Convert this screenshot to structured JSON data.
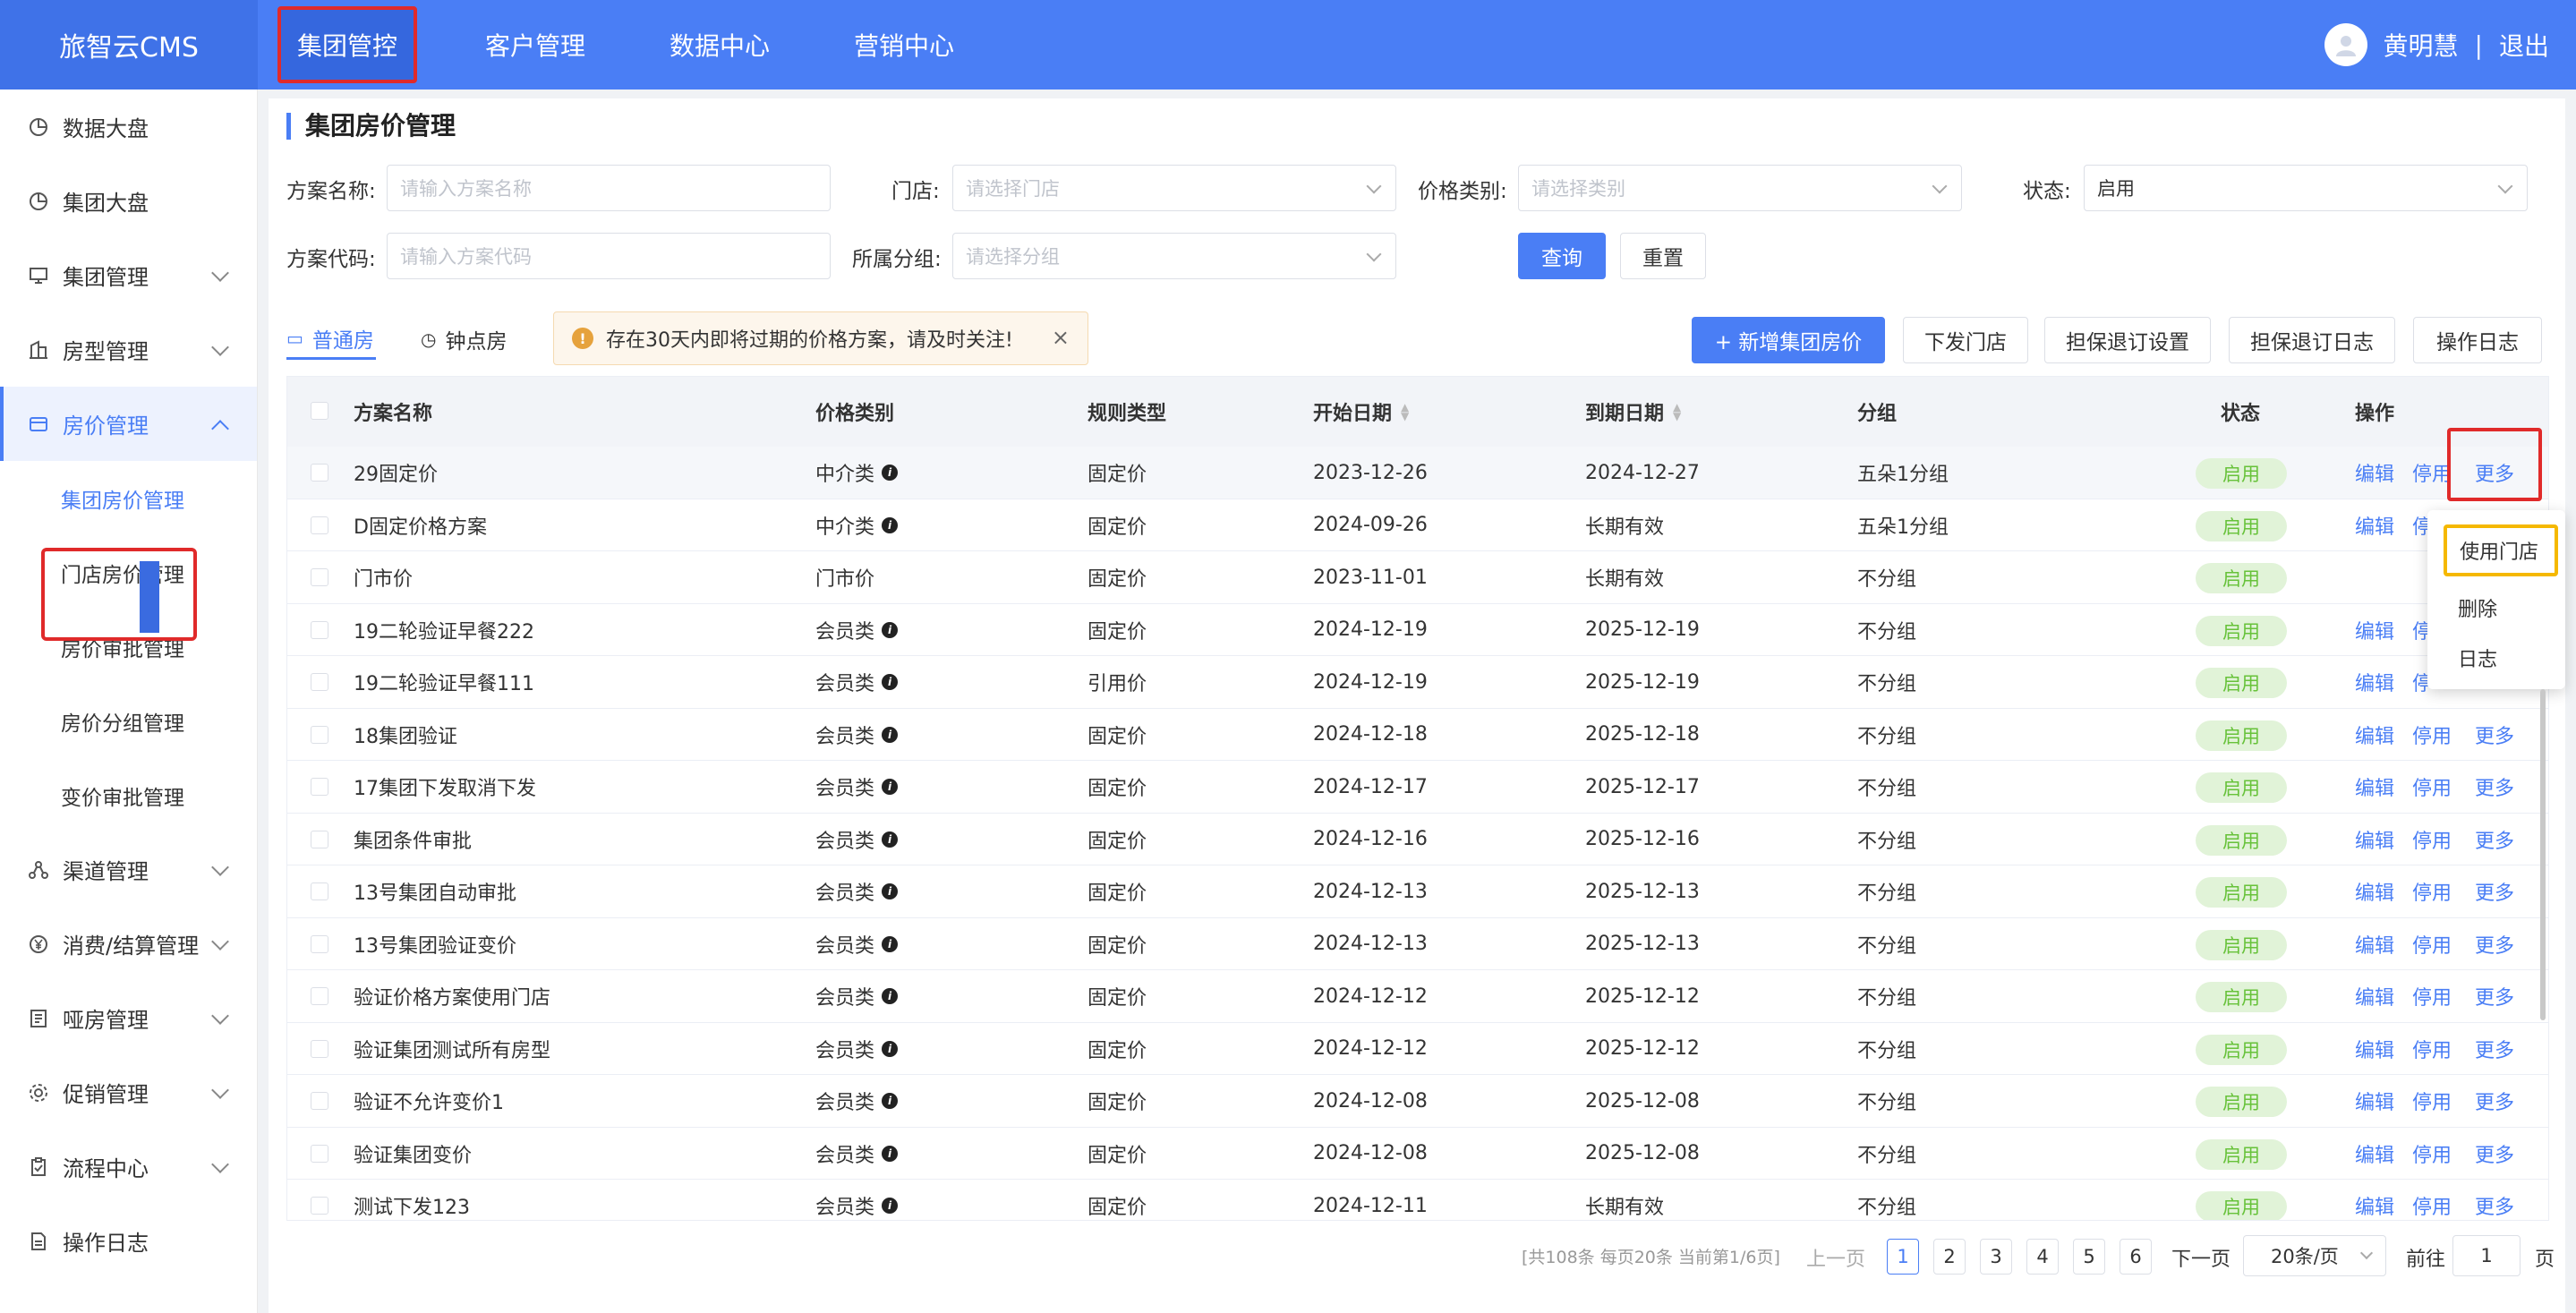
{
  "app": {
    "brand": "旅智云CMS"
  },
  "topnav": {
    "items": [
      "集团管控",
      "客户管理",
      "数据中心",
      "营销中心"
    ]
  },
  "user": {
    "name": "黄明慧",
    "separator": "|",
    "logout": "退出"
  },
  "sidebar": {
    "items": [
      {
        "label": "数据大盘",
        "icon": "pie-chart-icon"
      },
      {
        "label": "集团大盘",
        "icon": "pie-chart-icon"
      },
      {
        "label": "集团管理",
        "icon": "monitor-icon"
      },
      {
        "label": "房型管理",
        "icon": "building-icon"
      },
      {
        "label": "房价管理",
        "icon": "card-icon"
      },
      {
        "label": "渠道管理",
        "icon": "network-icon"
      },
      {
        "label": "消费/结算管理",
        "icon": "yen-icon"
      },
      {
        "label": "哑房管理",
        "icon": "doc-list-icon"
      },
      {
        "label": "促销管理",
        "icon": "gear-icon"
      },
      {
        "label": "流程中心",
        "icon": "clipboard-icon"
      },
      {
        "label": "操作日志",
        "icon": "file-icon"
      }
    ],
    "subitems": [
      "集团房价管理",
      "门店房价管理",
      "房价审批管理",
      "房价分组管理",
      "变价审批管理"
    ]
  },
  "page": {
    "title": "集团房价管理"
  },
  "filters": {
    "name_label": "方案名称:",
    "name_placeholder": "请输入方案名称",
    "store_label": "门店:",
    "store_placeholder": "请选择门店",
    "price_type_label": "价格类别:",
    "price_type_placeholder": "请选择类别",
    "status_label": "状态:",
    "status_value": "启用",
    "code_label": "方案代码:",
    "code_placeholder": "请输入方案代码",
    "group_label": "所属分组:",
    "group_placeholder": "请选择分组",
    "query": "查询",
    "reset": "重置"
  },
  "tabs": [
    "普通房",
    "钟点房"
  ],
  "notice": {
    "text": "存在30天内即将过期的价格方案，请及时关注!",
    "close": "×"
  },
  "toolbar": {
    "add": "+ 新增集团房价",
    "dispatch": "下发门店",
    "guarantee_settings": "担保退订设置",
    "guarantee_log": "担保退订日志",
    "op_log": "操作日志"
  },
  "table": {
    "headers": [
      "方案名称",
      "价格类别",
      "规则类型",
      "开始日期",
      "到期日期",
      "分组",
      "状态",
      "操作"
    ],
    "rows": [
      {
        "name": "29固定价",
        "price_type": "中介类",
        "info": true,
        "rule": "固定价",
        "start": "2023-12-26",
        "end": "2024-12-27",
        "group": "五朵1分组",
        "status": "启用",
        "ops": [
          "编辑",
          "停用",
          "更多"
        ]
      },
      {
        "name": "D固定价格方案",
        "price_type": "中介类",
        "info": true,
        "rule": "固定价",
        "start": "2024-09-26",
        "end": "长期有效",
        "group": "五朵1分组",
        "status": "启用",
        "ops": [
          "编辑",
          "停"
        ]
      },
      {
        "name": "门市价",
        "price_type": "门市价",
        "info": false,
        "rule": "固定价",
        "start": "2023-11-01",
        "end": "长期有效",
        "group": "不分组",
        "status": "启用",
        "ops": []
      },
      {
        "name": "19二轮验证早餐222",
        "price_type": "会员类",
        "info": true,
        "rule": "固定价",
        "start": "2024-12-19",
        "end": "2025-12-19",
        "group": "不分组",
        "status": "启用",
        "ops": [
          "编辑",
          "停"
        ]
      },
      {
        "name": "19二轮验证早餐111",
        "price_type": "会员类",
        "info": true,
        "rule": "引用价",
        "start": "2024-12-19",
        "end": "2025-12-19",
        "group": "不分组",
        "status": "启用",
        "ops": [
          "编辑",
          "停"
        ]
      },
      {
        "name": "18集团验证",
        "price_type": "会员类",
        "info": true,
        "rule": "固定价",
        "start": "2024-12-18",
        "end": "2025-12-18",
        "group": "不分组",
        "status": "启用",
        "ops": [
          "编辑",
          "停用",
          "更多"
        ]
      },
      {
        "name": "17集团下发取消下发",
        "price_type": "会员类",
        "info": true,
        "rule": "固定价",
        "start": "2024-12-17",
        "end": "2025-12-17",
        "group": "不分组",
        "status": "启用",
        "ops": [
          "编辑",
          "停用",
          "更多"
        ]
      },
      {
        "name": "集团条件审批",
        "price_type": "会员类",
        "info": true,
        "rule": "固定价",
        "start": "2024-12-16",
        "end": "2025-12-16",
        "group": "不分组",
        "status": "启用",
        "ops": [
          "编辑",
          "停用",
          "更多"
        ]
      },
      {
        "name": "13号集团自动审批",
        "price_type": "会员类",
        "info": true,
        "rule": "固定价",
        "start": "2024-12-13",
        "end": "2025-12-13",
        "group": "不分组",
        "status": "启用",
        "ops": [
          "编辑",
          "停用",
          "更多"
        ]
      },
      {
        "name": "13号集团验证变价",
        "price_type": "会员类",
        "info": true,
        "rule": "固定价",
        "start": "2024-12-13",
        "end": "2025-12-13",
        "group": "不分组",
        "status": "启用",
        "ops": [
          "编辑",
          "停用",
          "更多"
        ]
      },
      {
        "name": "验证价格方案使用门店",
        "price_type": "会员类",
        "info": true,
        "rule": "固定价",
        "start": "2024-12-12",
        "end": "2025-12-12",
        "group": "不分组",
        "status": "启用",
        "ops": [
          "编辑",
          "停用",
          "更多"
        ]
      },
      {
        "name": "验证集团测试所有房型",
        "price_type": "会员类",
        "info": true,
        "rule": "固定价",
        "start": "2024-12-12",
        "end": "2025-12-12",
        "group": "不分组",
        "status": "启用",
        "ops": [
          "编辑",
          "停用",
          "更多"
        ]
      },
      {
        "name": "验证不允许变价1",
        "price_type": "会员类",
        "info": true,
        "rule": "固定价",
        "start": "2024-12-08",
        "end": "2025-12-08",
        "group": "不分组",
        "status": "启用",
        "ops": [
          "编辑",
          "停用",
          "更多"
        ]
      },
      {
        "name": "验证集团变价",
        "price_type": "会员类",
        "info": true,
        "rule": "固定价",
        "start": "2024-12-08",
        "end": "2025-12-08",
        "group": "不分组",
        "status": "启用",
        "ops": [
          "编辑",
          "停用",
          "更多"
        ]
      },
      {
        "name": "测试下发123",
        "price_type": "会员类",
        "info": true,
        "rule": "固定价",
        "start": "2024-12-11",
        "end": "长期有效",
        "group": "不分组",
        "status": "启用",
        "ops": [
          "编辑",
          "停用",
          "更多"
        ]
      }
    ]
  },
  "more_menu": [
    "使用门店",
    "删除",
    "日志"
  ],
  "pagination": {
    "info": "[共108条 每页20条 当前第1/6页]",
    "prev": "上一页",
    "next": "下一页",
    "pages": [
      "1",
      "2",
      "3",
      "4",
      "5",
      "6"
    ],
    "current": "1",
    "page_size": "20条/页",
    "goto_label": "前往",
    "goto_value": "1",
    "goto_suffix": "页"
  },
  "colors": {
    "primary": "#4a7ef5",
    "highlight_red": "#e02a2a",
    "highlight_yellow": "#f5b800",
    "status_green": "#67c23a"
  }
}
